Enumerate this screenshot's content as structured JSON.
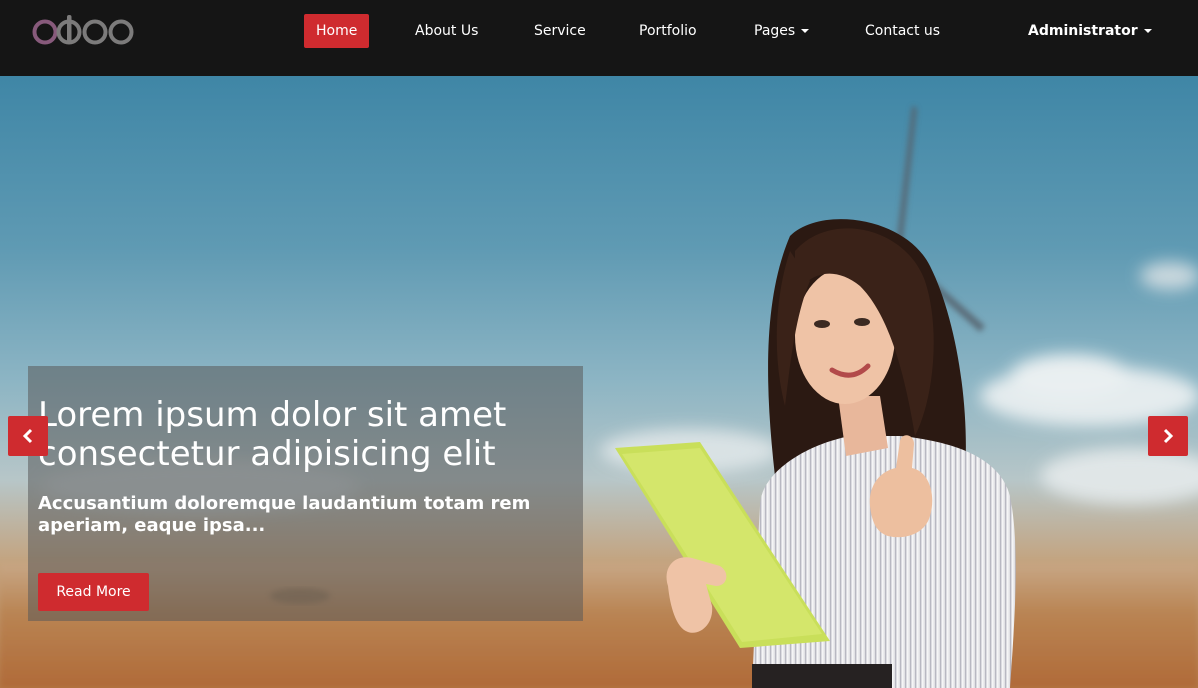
{
  "brand": {
    "name": "odoo",
    "color": "#7c7b7b",
    "accent": "#875a7b"
  },
  "nav": {
    "items": [
      {
        "label": "Home",
        "active": true
      },
      {
        "label": "About Us"
      },
      {
        "label": "Service"
      },
      {
        "label": "Portfolio"
      },
      {
        "label": "Pages",
        "dropdown": true
      },
      {
        "label": "Contact us"
      }
    ],
    "user": {
      "label": "Administrator",
      "dropdown": true
    }
  },
  "hero": {
    "title": "Lorem ipsum dolor sit amet consectetur adipisicing elit",
    "subtitle": "Accusantium doloremque laudantium totam rem aperiam, eaque ipsa...",
    "cta_label": "Read More",
    "prev_icon": "chevron-left-icon",
    "next_icon": "chevron-right-icon"
  },
  "colors": {
    "accent": "#cf2b2f",
    "navbar": "#151515"
  }
}
